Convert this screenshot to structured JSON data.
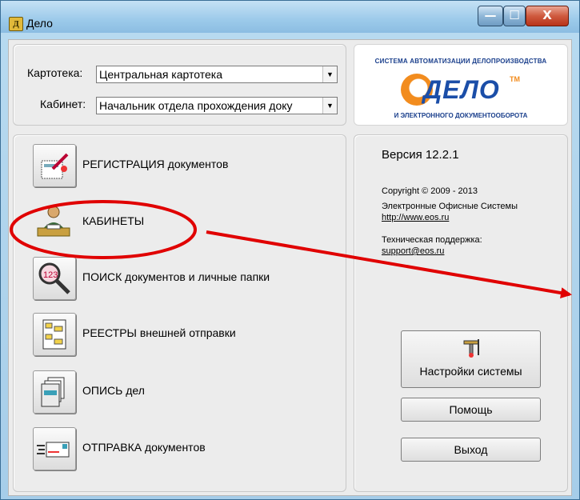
{
  "window": {
    "title": "Дело",
    "min_glyph": "—",
    "max_glyph": "☐",
    "close_glyph": "X"
  },
  "top_form": {
    "kartoteka_label": "Картотека:",
    "kartoteka_value": "Центральная картотека",
    "kabinet_label": "Кабинет:",
    "kabinet_value": "Начальник отдела прохождения доку",
    "dropdown_glyph": "▼"
  },
  "logo": {
    "top_text": "СИСТЕМА АВТОМАТИЗАЦИИ ДЕЛОПРОИЗВОДСТВА",
    "word": "ДЕЛО",
    "tm": "ТМ",
    "bottom_text": "И ЭЛЕКТРОННОГО ДОКУМЕНТООБОРОТА"
  },
  "menu": {
    "registration": "РЕГИСТРАЦИЯ  документов",
    "cabinets": "КАБИНЕТЫ",
    "search": "ПОИСК  документов и личные папки",
    "registers": "РЕЕСТРЫ  внешней отправки",
    "inventory": "ОПИСЬ дел",
    "dispatch": "ОТПРАВКА документов"
  },
  "info": {
    "version": "Версия 12.2.1",
    "copyright": "Copyright © 2009 - 2013",
    "company": "Электронные Офисные Системы",
    "url": "http://www.eos.ru",
    "support_label": "Техническая поддержка:",
    "support_email": "support@eos.ru"
  },
  "buttons": {
    "settings": "Настройки системы",
    "help": "Помощь",
    "exit": "Выход"
  },
  "annotation": {
    "color": "#e00000"
  }
}
